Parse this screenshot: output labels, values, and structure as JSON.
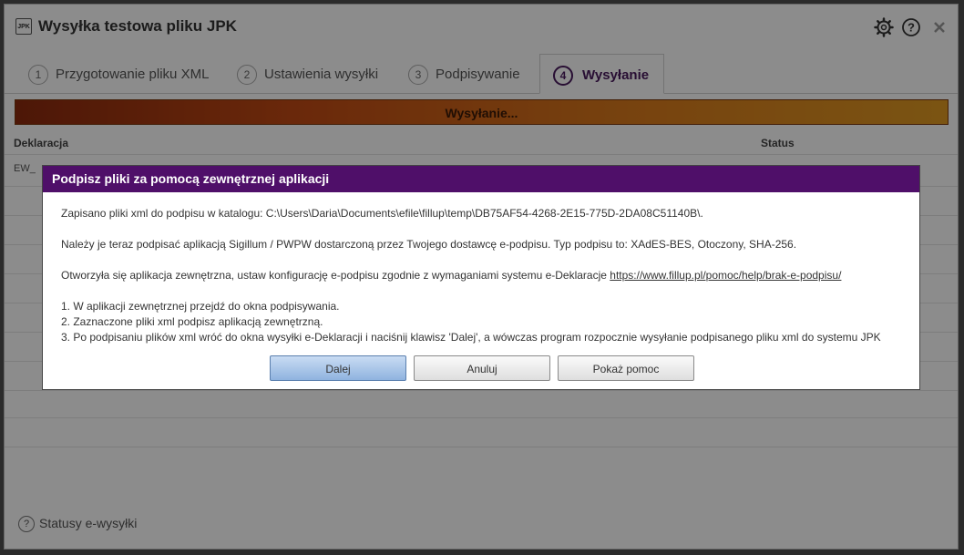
{
  "window": {
    "app_icon_text": "JPK",
    "title": "Wysyłka testowa pliku JPK"
  },
  "icons": {
    "settings": "gear-icon",
    "help": "help-icon",
    "close": "close-icon"
  },
  "tabs": [
    {
      "num": "1",
      "label": "Przygotowanie pliku XML"
    },
    {
      "num": "2",
      "label": "Ustawienia wysyłki"
    },
    {
      "num": "3",
      "label": "Podpisywanie"
    },
    {
      "num": "4",
      "label": "Wysyłanie"
    }
  ],
  "progress": {
    "label": "Wysyłanie..."
  },
  "table": {
    "headers": {
      "declaration": "Deklaracja",
      "status": "Status"
    },
    "first_row_prefix": "EW_"
  },
  "dialog": {
    "title": "Podpisz pliki za pomocą zewnętrznej aplikacji",
    "line1": "Zapisano pliki xml do podpisu w katalogu: C:\\Users\\Daria\\Documents\\efile\\fillup\\temp\\DB75AF54-4268-2E15-775D-2DA08C51140B\\.",
    "line2": "Należy je teraz podpisać aplikacją Sigillum / PWPW dostarczoną przez Twojego dostawcę e-podpisu. Typ podpisu to: XAdES-BES, Otoczony, SHA-256.",
    "line3_text": "Otworzyła się aplikacja zewnętrzna, ustaw konfigurację e-podpisu zgodnie z wymaganiami systemu e-Deklaracje ",
    "line3_link": "https://www.fillup.pl/pomoc/help/brak-e-podpisu/",
    "step1": "1. W aplikacji zewnętrznej przejdź do okna podpisywania.",
    "step2": "2. Zaznaczone pliki xml podpisz aplikacją zewnętrzną.",
    "step3": "3. Po podpisaniu plików xml wróć do okna wysyłki e-Deklaracji i naciśnij klawisz 'Dalej', a wówczas program rozpocznie wysyłanie podpisanego pliku xml do systemu JPK",
    "buttons": {
      "next": "Dalej",
      "cancel": "Anuluj",
      "help": "Pokaż pomoc"
    }
  },
  "footer": {
    "link": "Statusy e-wysyłki"
  },
  "colors": {
    "accent": "#4f0f69",
    "progress_start": "#8c2a0e",
    "progress_end": "#e09a22"
  }
}
